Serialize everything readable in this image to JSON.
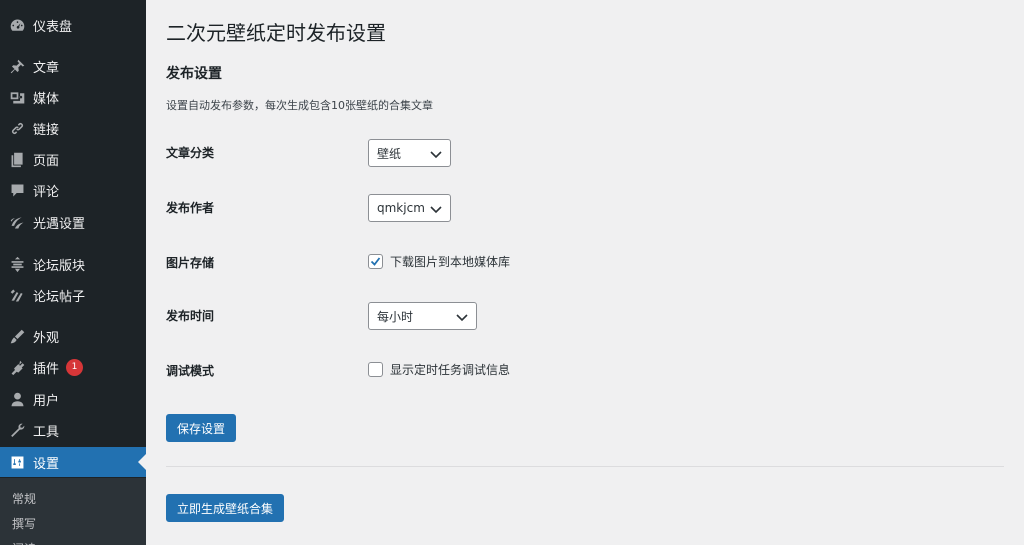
{
  "sidebar": {
    "items": [
      {
        "label": "仪表盘",
        "icon": "dashboard-icon"
      },
      {
        "label": "文章",
        "icon": "pin-icon"
      },
      {
        "label": "媒体",
        "icon": "media-icon"
      },
      {
        "label": "链接",
        "icon": "link-icon"
      },
      {
        "label": "页面",
        "icon": "page-icon"
      },
      {
        "label": "评论",
        "icon": "comment-icon"
      },
      {
        "label": "光遇设置",
        "icon": "sky-icon"
      },
      {
        "label": "论坛版块",
        "icon": "forum-icon"
      },
      {
        "label": "论坛帖子",
        "icon": "topic-icon"
      },
      {
        "label": "外观",
        "icon": "appearance-icon"
      },
      {
        "label": "插件",
        "icon": "plugin-icon",
        "badge": "1"
      },
      {
        "label": "用户",
        "icon": "user-icon"
      },
      {
        "label": "工具",
        "icon": "tools-icon"
      },
      {
        "label": "设置",
        "icon": "settings-icon",
        "current": true
      }
    ],
    "submenu": [
      "常规",
      "撰写",
      "阅读"
    ]
  },
  "page": {
    "title": "二次元壁纸定时发布设置",
    "section_title": "发布设置",
    "section_desc": "设置自动发布参数，每次生成包含10张壁纸的合集文章",
    "fields": {
      "category": {
        "label": "文章分类",
        "value": "壁纸"
      },
      "author": {
        "label": "发布作者",
        "value": "qmkjcm"
      },
      "storage": {
        "label": "图片存储",
        "checkbox_label": "下载图片到本地媒体库",
        "checked": true
      },
      "schedule": {
        "label": "发布时间",
        "value": "每小时"
      },
      "debug": {
        "label": "调试模式",
        "checkbox_label": "显示定时任务调试信息",
        "checked": false
      }
    },
    "save_button": "保存设置",
    "generate_button": "立即生成壁纸合集"
  },
  "colors": {
    "sidebar_bg": "#1d2327",
    "accent": "#2271b1",
    "badge": "#d63638",
    "page_bg": "#f0f0f1"
  }
}
